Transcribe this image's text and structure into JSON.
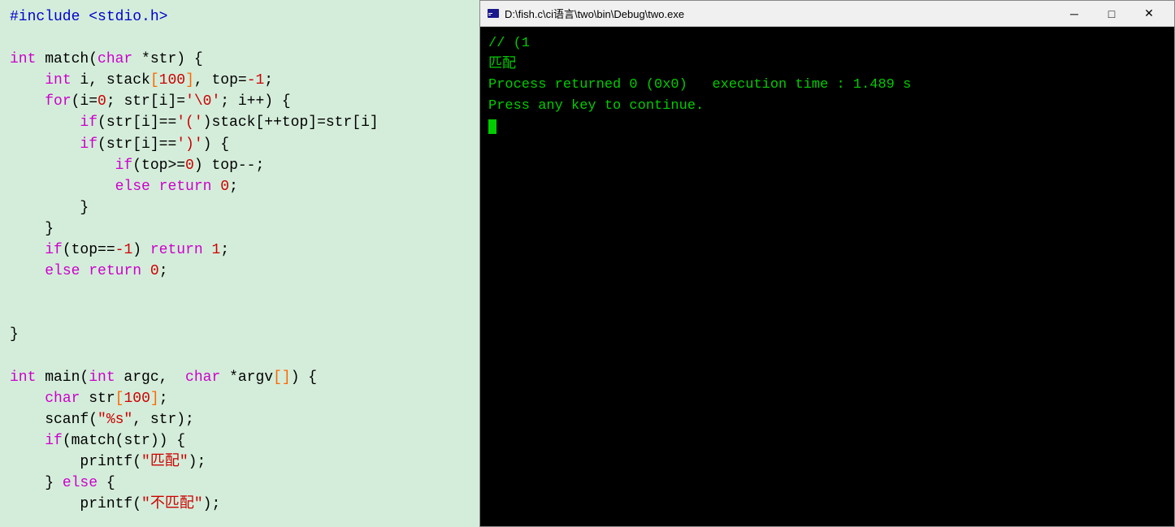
{
  "editor": {
    "background": "#d4edda",
    "code_lines": [
      "#include <stdio.h>",
      "",
      "int match(char *str) {",
      "    int i, stack[100], top=-1;",
      "    for(i=0; str[i]='\\0'; i++) {",
      "        if(str[i]=='(')stack[++top]=str[i]",
      "        if(str[i]==')') {",
      "            if(top>=0) top--;",
      "            else return 0;",
      "        }",
      "    }",
      "    if(top==-1) return 1;",
      "    else return 0;",
      "",
      "",
      "}",
      "",
      "int main(int argc, char *argv[]) {",
      "    char str[100];",
      "    scanf(\"%s\", str);",
      "    if(match(str)) {",
      "        printf(\"匹配\");",
      "    } else {",
      "        printf(\"不匹配\");"
    ]
  },
  "terminal": {
    "title": "D:\\fish.c\\ci语言\\two\\bin\\Debug\\two.exe",
    "icon": "▣",
    "lines": [
      "// (1",
      "匹配",
      "Process returned 0 (0x0)   execution time : 1.489 s",
      "Press any key to continue."
    ],
    "minimize_label": "─",
    "maximize_label": "□",
    "close_label": "✕"
  }
}
